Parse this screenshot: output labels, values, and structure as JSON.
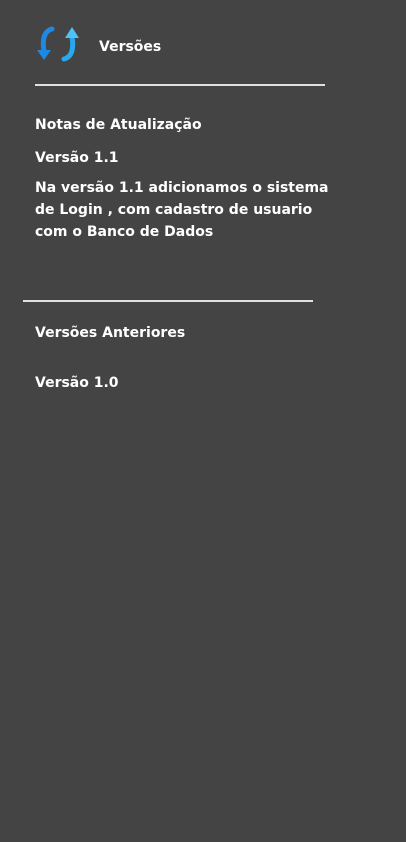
{
  "header": {
    "title": "Versões",
    "icon": "refresh-icon",
    "icon_colors": {
      "primary": "#1e88e5",
      "light": "#4fc3f7"
    }
  },
  "update_notes": {
    "heading": "Notas de Atualização",
    "current_version": "Versão 1.1",
    "body": "Na versão 1.1 adicionamos o sistema de Login , com cadastro de usuario com o Banco de Dados"
  },
  "previous_versions": {
    "heading": "Versões Anteriores",
    "items": [
      {
        "label": "Versão 1.0"
      }
    ]
  },
  "colors": {
    "background": "#444444",
    "text": "#ffffff",
    "divider": "#e0e0e0"
  }
}
